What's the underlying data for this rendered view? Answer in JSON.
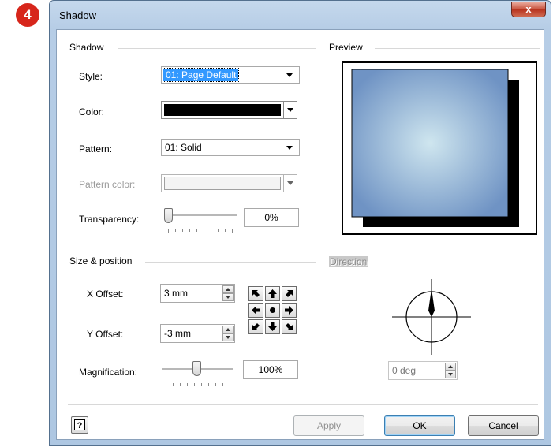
{
  "step_badge": "4",
  "dialog": {
    "title": "Shadow",
    "close_label": "x"
  },
  "shadow_group": {
    "label": "Shadow",
    "style_label": "Style:",
    "style_value": "01: Page Default",
    "color_label": "Color:",
    "color_value": "#000000",
    "pattern_label": "Pattern:",
    "pattern_value": "01: Solid",
    "pattern_color_label": "Pattern color:",
    "transparency_label": "Transparency:",
    "transparency_value": "0%"
  },
  "preview_group": {
    "label": "Preview"
  },
  "size_group": {
    "label": "Size & position",
    "x_offset_label": "X Offset:",
    "x_offset_value": "3 mm",
    "y_offset_label": "Y Offset:",
    "y_offset_value": "-3 mm",
    "magnification_label": "Magnification:",
    "magnification_value": "100%"
  },
  "direction_group": {
    "label": "Direction",
    "value": "0 deg"
  },
  "buttons": {
    "help": "?",
    "apply": "Apply",
    "ok": "OK",
    "cancel": "Cancel"
  },
  "icons": {
    "nudge": [
      "arrow-up-left-icon",
      "arrow-up-icon",
      "arrow-up-right-icon",
      "arrow-left-icon",
      "center-dot-icon",
      "arrow-right-icon",
      "arrow-down-left-icon",
      "arrow-down-icon",
      "arrow-down-right-icon"
    ]
  },
  "colors": {
    "preview_fill_center": "#cfe6ef",
    "preview_fill_edge": "#6f93c4",
    "shadow": "#000000",
    "selection": "#3399ff",
    "badge": "#d7261b"
  }
}
